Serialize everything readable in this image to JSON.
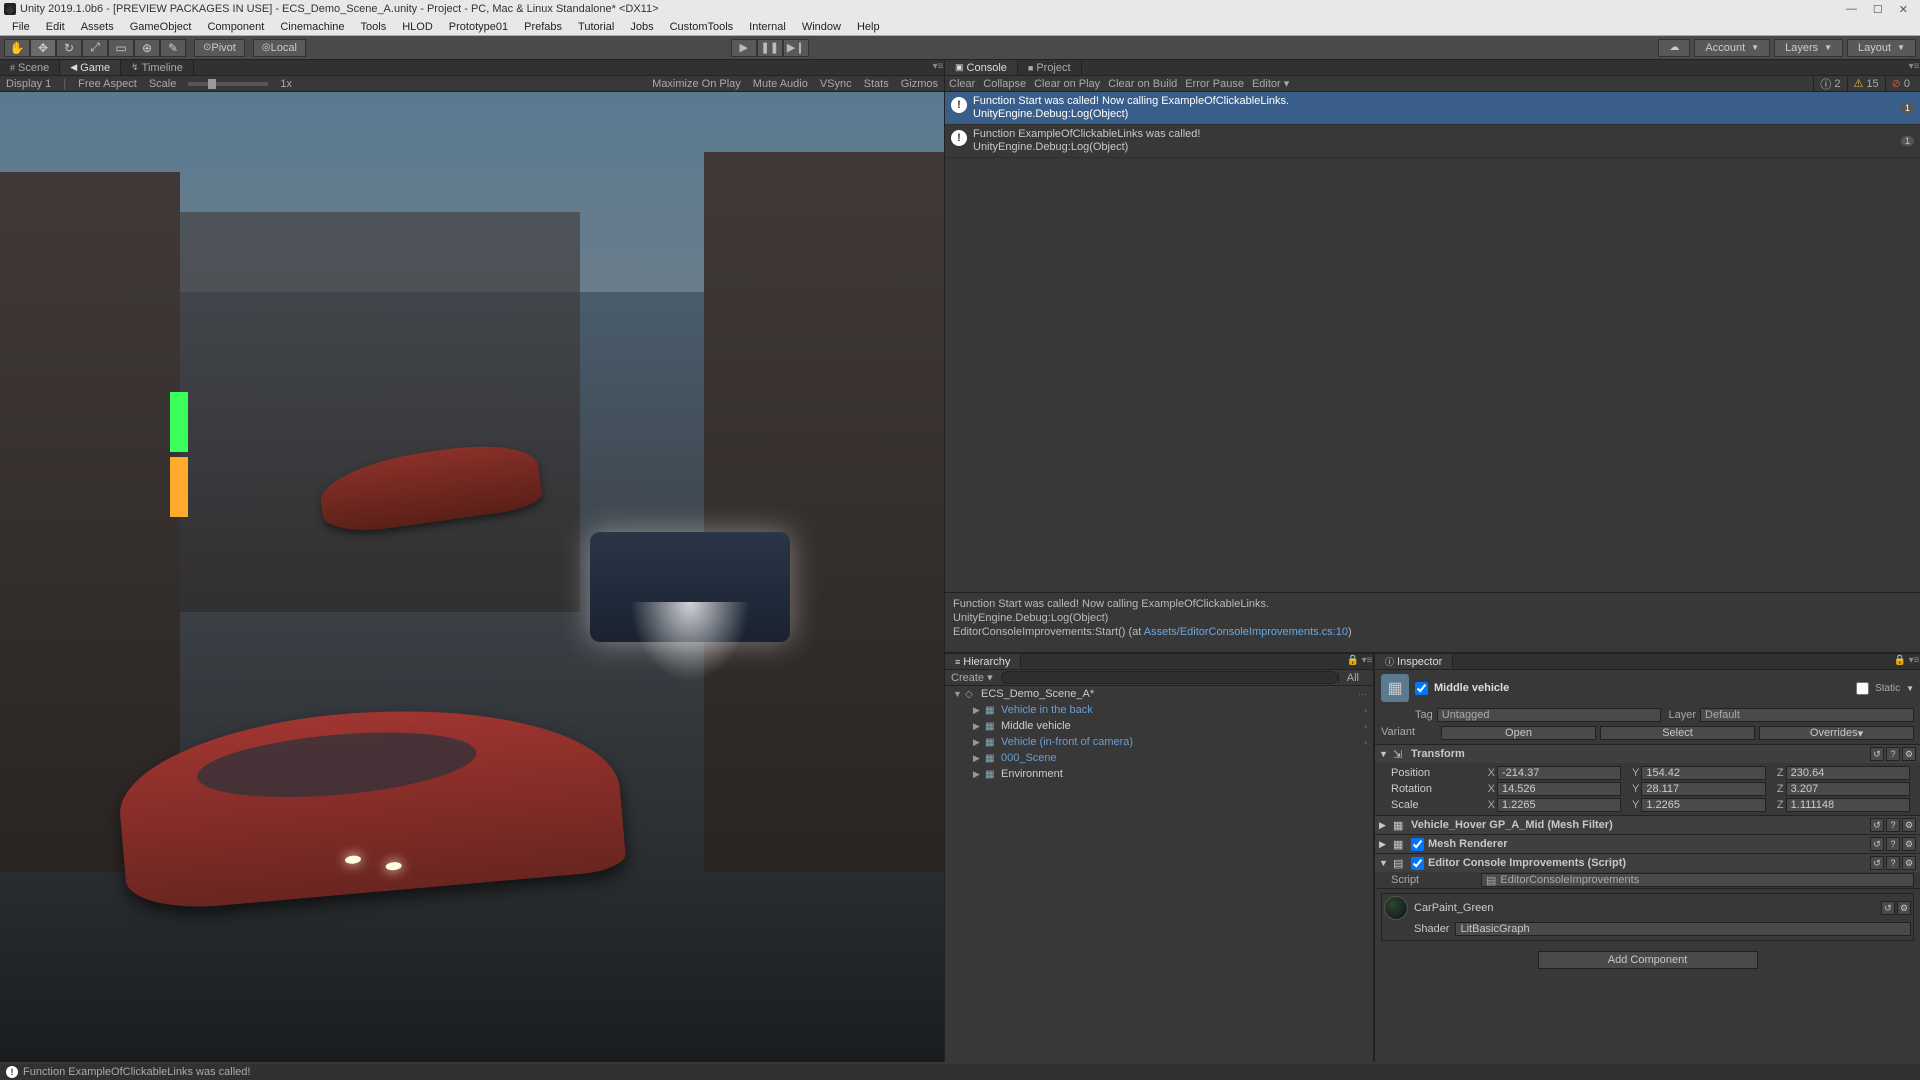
{
  "window": {
    "title": "Unity 2019.1.0b6 - [PREVIEW PACKAGES IN USE] - ECS_Demo_Scene_A.unity - Project - PC, Mac & Linux Standalone* <DX11>"
  },
  "menu": [
    "File",
    "Edit",
    "Assets",
    "GameObject",
    "Component",
    "Cinemachine",
    "Tools",
    "HLOD",
    "Prototype01",
    "Prefabs",
    "Tutorial",
    "Jobs",
    "CustomTools",
    "Internal",
    "Window",
    "Help"
  ],
  "toolbar": {
    "pivot": "Pivot",
    "local": "Local",
    "account": "Account",
    "layers": "Layers",
    "layout": "Layout"
  },
  "tabs_left": [
    {
      "label": "Scene",
      "icon": "#"
    },
    {
      "label": "Game",
      "icon": "◀"
    },
    {
      "label": "Timeline",
      "icon": "↯"
    }
  ],
  "gamebar": {
    "display": "Display 1",
    "aspect": "Free Aspect",
    "scale": "Scale",
    "scale_val": "1x",
    "max": "Maximize On Play",
    "mute": "Mute Audio",
    "vsync": "VSync",
    "stats": "Stats",
    "gizmos": "Gizmos"
  },
  "tabs_console": [
    {
      "label": "Console",
      "icon": "▣"
    },
    {
      "label": "Project",
      "icon": "■"
    }
  ],
  "console_ctl": {
    "clear": "Clear",
    "collapse": "Collapse",
    "cop": "Clear on Play",
    "cob": "Clear on Build",
    "ep": "Error Pause",
    "editor": "Editor",
    "info_n": "2",
    "warn_n": "15",
    "err_n": "0"
  },
  "console_rows": [
    {
      "msg": "Function Start was called! Now calling ExampleOfClickableLinks.",
      "sub": "UnityEngine.Debug:Log(Object)",
      "count": "1"
    },
    {
      "msg": "Function ExampleOfClickableLinks was called!",
      "sub": "UnityEngine.Debug:Log(Object)",
      "count": "1"
    }
  ],
  "console_detail": {
    "l1": "Function Start was called! Now calling ExampleOfClickableLinks.",
    "l2": "UnityEngine.Debug:Log(Object)",
    "l3a": "EditorConsoleImprovements:Start() (at ",
    "l3b": "Assets/EditorConsoleImprovements.cs:10",
    "l3c": ")"
  },
  "hierarchy": {
    "tab": "Hierarchy",
    "create": "Create",
    "all": "All",
    "root": "ECS_Demo_Scene_A*",
    "items": [
      {
        "label": "Vehicle in the back",
        "type": "prefab",
        "arrow": true
      },
      {
        "label": "Middle vehicle",
        "type": "normal",
        "arrow": true
      },
      {
        "label": "Vehicle (in-front of camera)",
        "type": "prefab",
        "arrow": true
      },
      {
        "label": "000_Scene",
        "type": "prefab",
        "arrow": false
      },
      {
        "label": "Environment",
        "type": "normal",
        "arrow": false
      }
    ]
  },
  "inspector": {
    "tab": "Inspector",
    "name": "Middle vehicle",
    "static": "Static",
    "tag_lbl": "Tag",
    "tag_val": "Untagged",
    "layer_lbl": "Layer",
    "layer_val": "Default",
    "variant_lbl": "Variant",
    "open": "Open",
    "select": "Select",
    "overrides": "Overrides",
    "transform": {
      "title": "Transform",
      "pos_lbl": "Position",
      "pos": [
        "-214.37",
        "154.42",
        "230.64"
      ],
      "rot_lbl": "Rotation",
      "rot": [
        "14.526",
        "28.117",
        "3.207"
      ],
      "scl_lbl": "Scale",
      "scl": [
        "1.2265",
        "1.2265",
        "1.111148"
      ]
    },
    "meshfilter": "Vehicle_Hover GP_A_Mid (Mesh Filter)",
    "meshrenderer": "Mesh Renderer",
    "script_comp": "Editor Console Improvements (Script)",
    "script_lbl": "Script",
    "script_val": "EditorConsoleImprovements",
    "mat_name": "CarPaint_Green",
    "shader_lbl": "Shader",
    "shader_val": "LitBasicGraph",
    "add": "Add Component"
  },
  "status": "Function ExampleOfClickableLinks was called!"
}
